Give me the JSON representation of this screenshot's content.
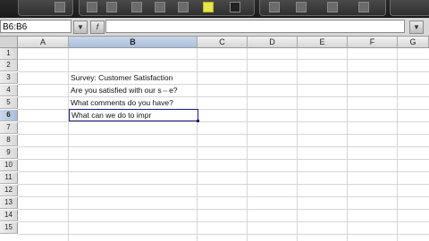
{
  "formula_bar": {
    "name_box": "B6:B6",
    "fx_label": "f",
    "formula_value": ""
  },
  "columns": [
    "A",
    "B",
    "C",
    "D",
    "E",
    "F",
    "G"
  ],
  "rows": [
    "1",
    "2",
    "3",
    "4",
    "5",
    "6",
    "7",
    "8",
    "9",
    "10",
    "11",
    "12",
    "13",
    "14",
    "15"
  ],
  "cells": {
    "B3": "Survey: Customer Satisfaction",
    "B4": "Are you satisfied with our s",
    "B4_tail": "e?",
    "B5": "What comments do you have?",
    "B6": "What can we do to impr"
  },
  "selected": {
    "column": "B",
    "row": "6"
  }
}
